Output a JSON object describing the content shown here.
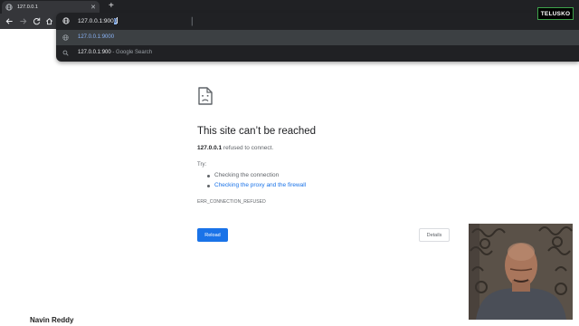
{
  "browser": {
    "tab": {
      "title": "127.0.0.1",
      "favicon": "globe-icon"
    },
    "new_tab_label": "+",
    "omnibox": {
      "typed": "127.0.0.1:900",
      "autocomplete": "0",
      "suggestions": [
        {
          "icon": "globe-icon",
          "main": "127.0.0.1:9000",
          "hint": "",
          "selected": true
        },
        {
          "icon": "search-icon",
          "main": "127.0.0.1:900",
          "hint": " - Google Search",
          "selected": false
        }
      ]
    },
    "colors": {
      "chrome_dark": "#202124",
      "chrome_toolbar": "#35363a",
      "link_blue": "#8ab4f8"
    }
  },
  "brand_badge": "TELUSKO",
  "error_page": {
    "icon": "sad-page-icon",
    "title": "This site can’t be reached",
    "host": "127.0.0.1",
    "message": " refused to connect.",
    "try_label": "Try:",
    "suggestions": [
      {
        "text": "Checking the connection",
        "link": false
      },
      {
        "text": "Checking the proxy and the firewall",
        "link": true
      }
    ],
    "error_code": "ERR_CONNECTION_REFUSED",
    "reload_label": "Reload",
    "details_label": "Details",
    "colors": {
      "primary_button": "#1a73e8",
      "title": "#202124"
    }
  },
  "overlay": {
    "presenter_name": "Navin Reddy",
    "webcam": "presenter-webcam"
  }
}
